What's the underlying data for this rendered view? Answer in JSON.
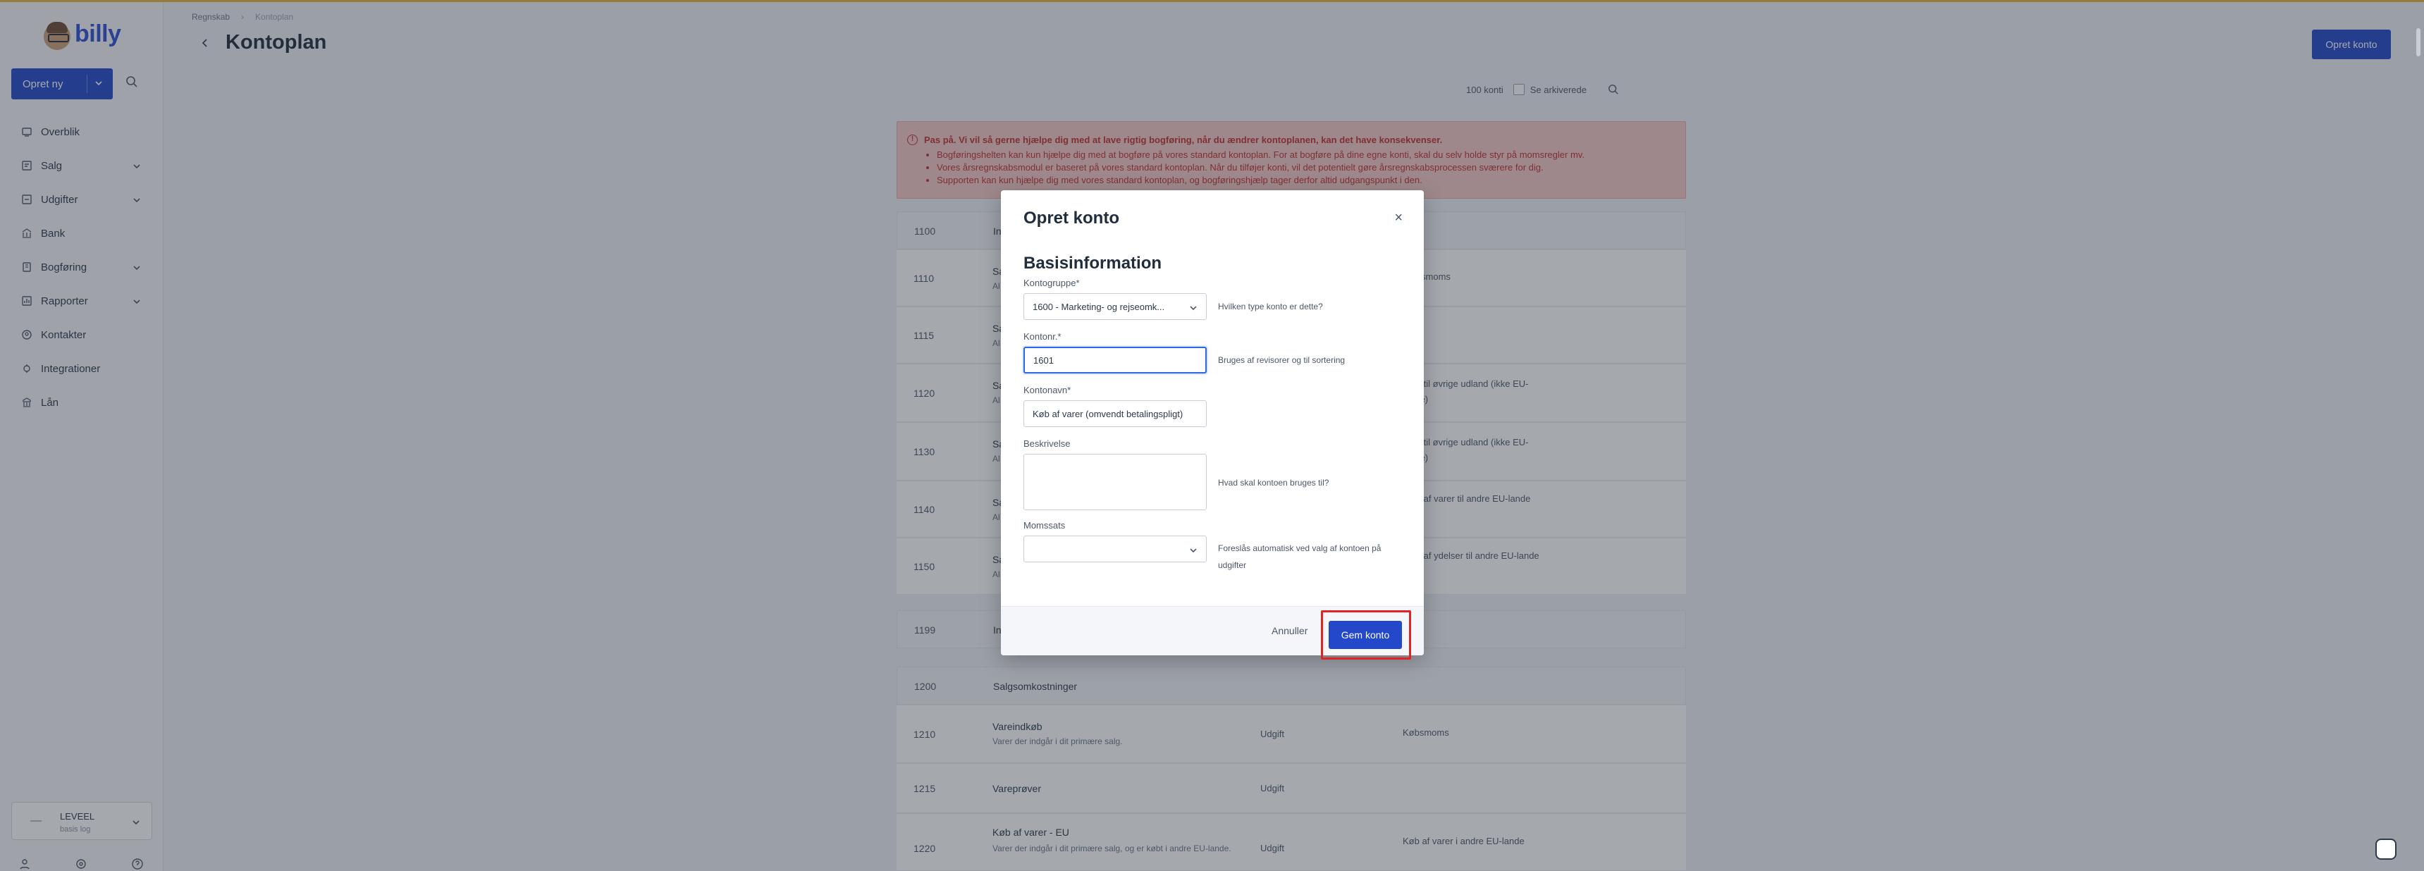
{
  "brand": {
    "name": "billy"
  },
  "sidebar": {
    "create_label": "Opret ny",
    "items": [
      {
        "label": "Overblik",
        "icon": "overview-icon",
        "has_children": false
      },
      {
        "label": "Salg",
        "icon": "sales-icon",
        "has_children": true
      },
      {
        "label": "Udgifter",
        "icon": "expenses-icon",
        "has_children": true
      },
      {
        "label": "Bank",
        "icon": "bank-icon",
        "has_children": false
      },
      {
        "label": "Bogføring",
        "icon": "bookkeeping-icon",
        "has_children": true
      },
      {
        "label": "Rapporter",
        "icon": "reports-icon",
        "has_children": true
      },
      {
        "label": "Kontakter",
        "icon": "contacts-icon",
        "has_children": false
      },
      {
        "label": "Integrationer",
        "icon": "integrations-icon",
        "has_children": false
      },
      {
        "label": "Lån",
        "icon": "loan-icon",
        "has_children": false
      }
    ],
    "org": {
      "name": "LEVEEL",
      "plan": "basis log"
    }
  },
  "header": {
    "breadcrumb": [
      "Regnskab",
      "Kontoplan"
    ],
    "title": "Kontoplan",
    "primary_label": "Opret konto"
  },
  "toolbar": {
    "count": "100 konti",
    "archived_label": "Se arkiverede"
  },
  "warning": {
    "title": "Pas på. Vi vil så gerne hjælpe dig med at lave rigtig bogføring, når du ændrer kontoplanen, kan det have konsekvenser.",
    "bullets": [
      "Bogføringshelten kan kun hjælpe dig med at bogføre på vores standard kontoplan. For at bogføre på dine egne konti, skal du selv holde styr på momsregler mv.",
      "Vores årsregnskabsmodul er baseret på vores standard kontoplan. Når du tilføjer konti, vil det potentielt gøre årsregnskabsprocessen sværere for dig.",
      "Supporten kan kun hjælpe dig med vores standard kontoplan, og bogføringshjælp tager derfor altid udgangspunkt i den."
    ]
  },
  "table": {
    "rows": [
      {
        "num": "1100",
        "name": "In",
        "desc": "",
        "type": "",
        "vat": "",
        "head": true
      },
      {
        "num": "1110",
        "name": "Sa",
        "desc": "Al",
        "type": "",
        "vat": "Salgsmoms"
      },
      {
        "num": "1115",
        "name": "Sa",
        "desc": "Al",
        "type": "",
        "vat": ""
      },
      {
        "num": "1120",
        "name": "Sa",
        "desc": "Al",
        "type": "",
        "vat": "Salg til øvrige udland (ikke EU-lande)"
      },
      {
        "num": "1130",
        "name": "Sa",
        "desc": "Al",
        "type": "",
        "vat": "Salg til øvrige udland (ikke EU-lande)"
      },
      {
        "num": "1140",
        "name": "Sa",
        "desc": "Al",
        "type": "",
        "vat": "Salg af varer til andre EU-lande"
      },
      {
        "num": "1150",
        "name": "Sa",
        "desc": "Al",
        "type": "",
        "vat": "Salg af ydelser til andre EU-lande"
      },
      {
        "num": "1199",
        "name": "In",
        "desc": "",
        "type": "",
        "vat": "",
        "head": true
      },
      {
        "num": "1200",
        "name": "Salgsomkostninger",
        "desc": "",
        "type": "",
        "vat": "",
        "head": true
      },
      {
        "num": "1210",
        "name": "Vareindkøb",
        "desc": "Varer der indgår i dit primære salg.",
        "type": "Udgift",
        "vat": "Købsmoms"
      },
      {
        "num": "1215",
        "name": "Vareprøver",
        "desc": "",
        "type": "Udgift",
        "vat": ""
      },
      {
        "num": "1220",
        "name": "Køb af varer - EU",
        "desc": "Varer der indgår i dit primære salg, og er købt i andre EU-lande.",
        "type": "Udgift",
        "vat": "Køb af varer i andre EU-lande"
      }
    ]
  },
  "modal": {
    "title": "Opret konto",
    "section": "Basisinformation",
    "fields": {
      "group_label": "Kontogruppe*",
      "group_value": "1600 - Marketing- og rejseomk...",
      "group_help": "Hvilken type konto er dette?",
      "number_label": "Kontonr.*",
      "number_value": "1601",
      "number_help": "Bruges af revisorer og til sortering",
      "name_label": "Kontonavn*",
      "name_value": "Køb af varer (omvendt betalingspligt)",
      "desc_label": "Beskrivelse",
      "desc_value": "",
      "desc_help": "Hvad skal kontoen bruges til?",
      "vat_label": "Momssats",
      "vat_value": "",
      "vat_help": "Foreslås automatisk ved valg af kontoen på udgifter"
    },
    "cancel_label": "Annuller",
    "save_label": "Gem konto"
  },
  "colors": {
    "primary": "#2348c9",
    "warning_bg": "#f3c8c6",
    "warning_text": "#c0302b",
    "highlight": "#e02424"
  }
}
